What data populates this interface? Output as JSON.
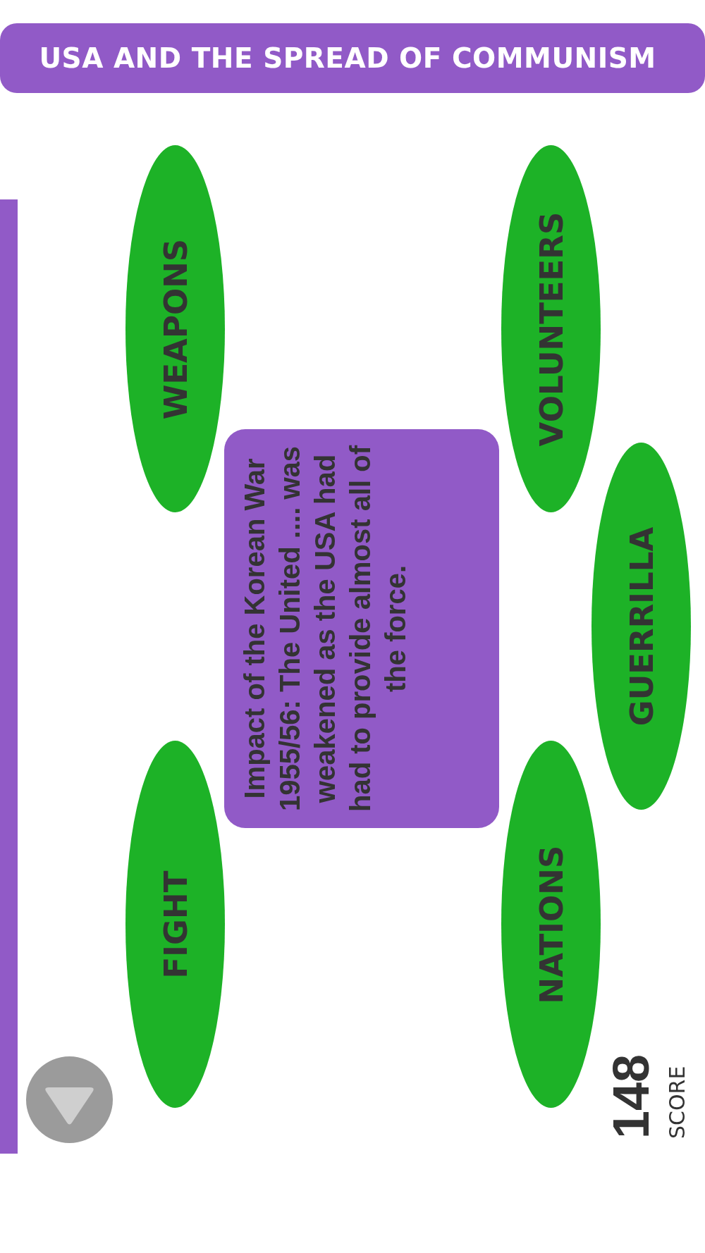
{
  "header": {
    "title": "USA AND THE SPREAD OF COMMUNISM"
  },
  "question": {
    "text": "Impact of the Korean War 1955/56: The United .... was weakened as the USA had had to provide almost all of the force."
  },
  "answers": [
    {
      "label": "WEAPONS"
    },
    {
      "label": "VOLUNTEERS"
    },
    {
      "label": "GUERRILLA"
    },
    {
      "label": "FIGHT"
    },
    {
      "label": "NATIONS"
    }
  ],
  "score": {
    "value": "148",
    "label": "SCORE"
  }
}
